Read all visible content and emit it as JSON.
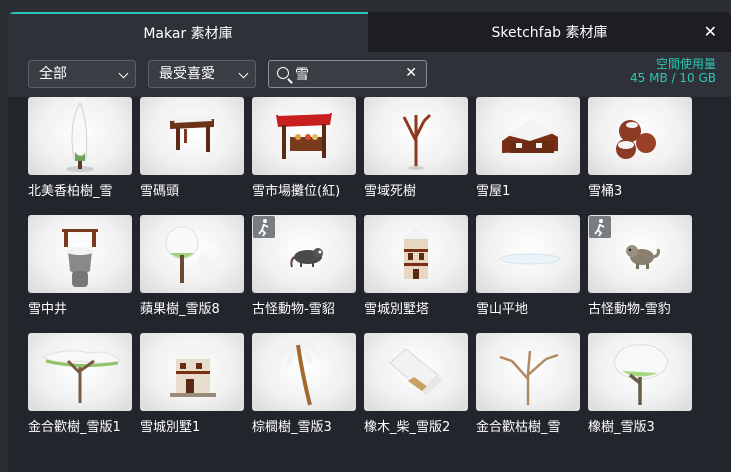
{
  "tabs": [
    {
      "label": "Makar 素材庫",
      "active": true
    },
    {
      "label": "Sketchfab 素材庫",
      "active": false
    }
  ],
  "close_icon": "close-icon",
  "filters": {
    "category": "全部",
    "sort": "最受喜愛"
  },
  "search": {
    "value": "雪"
  },
  "storage": {
    "title": "空間使用量",
    "usage": "45 MB / 10 GB"
  },
  "colors": {
    "accent": "#27c5bd",
    "storage_text": "#2cc7b5",
    "background": "#22252b"
  },
  "assets": [
    {
      "label": "北美香柏樹_雪",
      "icon": "snowy-cedar-tree",
      "animated": false
    },
    {
      "label": "雪碼頭",
      "icon": "snowy-dock",
      "animated": false
    },
    {
      "label": "雪市場攤位(紅)",
      "icon": "snowy-market-stall-red",
      "animated": false
    },
    {
      "label": "雪域死樹",
      "icon": "snowy-dead-tree",
      "animated": false
    },
    {
      "label": "雪屋1",
      "icon": "snowy-house-ruin",
      "animated": false
    },
    {
      "label": "雪桶3",
      "icon": "snowy-barrels",
      "animated": false
    },
    {
      "label": "雪中井",
      "icon": "snowy-well",
      "animated": false
    },
    {
      "label": "蘋果樹_雪版8",
      "icon": "snowy-apple-tree",
      "animated": false
    },
    {
      "label": "古怪動物-雪貂",
      "icon": "ferret-creature",
      "animated": true
    },
    {
      "label": "雪城別墅塔",
      "icon": "snowy-villa-tower",
      "animated": false
    },
    {
      "label": "雪山平地",
      "icon": "snow-flatland",
      "animated": false
    },
    {
      "label": "古怪動物-雪豹",
      "icon": "snow-leopard-creature",
      "animated": true
    },
    {
      "label": "金合歡樹_雪版1",
      "icon": "snowy-acacia-tree",
      "animated": false
    },
    {
      "label": "雪城別墅1",
      "icon": "snowy-villa",
      "animated": false
    },
    {
      "label": "棕櫚樹_雪版3",
      "icon": "snowy-palm-tree",
      "animated": false
    },
    {
      "label": "橡木_柴_雪版2",
      "icon": "snowy-oak-log",
      "animated": false
    },
    {
      "label": "金合歡枯樹_雪",
      "icon": "snowy-dead-acacia",
      "animated": false
    },
    {
      "label": "橡樹_雪版3",
      "icon": "snowy-oak-tree",
      "animated": false
    }
  ]
}
